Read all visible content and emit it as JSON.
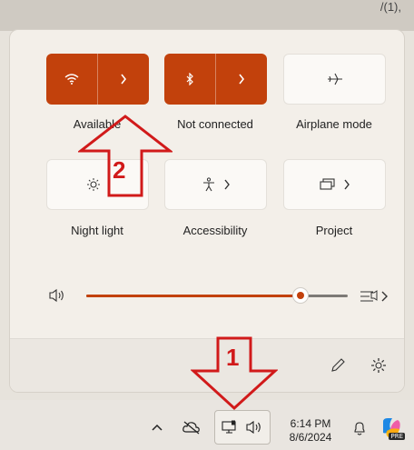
{
  "top_fragment": "/(1),",
  "tiles": [
    {
      "label": "Available",
      "icon": "wifi-icon",
      "state": "on"
    },
    {
      "label": "Not connected",
      "icon": "bluetooth-icon",
      "state": "on"
    },
    {
      "label": "Airplane mode",
      "icon": "airplane-icon",
      "state": "off"
    },
    {
      "label": "Night light",
      "icon": "brightness-icon",
      "state": "off"
    },
    {
      "label": "Accessibility",
      "icon": "accessibility-icon",
      "state": "off"
    },
    {
      "label": "Project",
      "icon": "project-icon",
      "state": "off"
    }
  ],
  "volume": {
    "level_fraction": 0.82,
    "icon": "speaker-icon"
  },
  "annotations": {
    "arrow1": "1",
    "arrow2": "2"
  },
  "taskbar": {
    "time": "6:14 PM",
    "date": "8/6/2024"
  },
  "colors": {
    "accent": "#c2410c",
    "annotation": "#d11a1a"
  }
}
